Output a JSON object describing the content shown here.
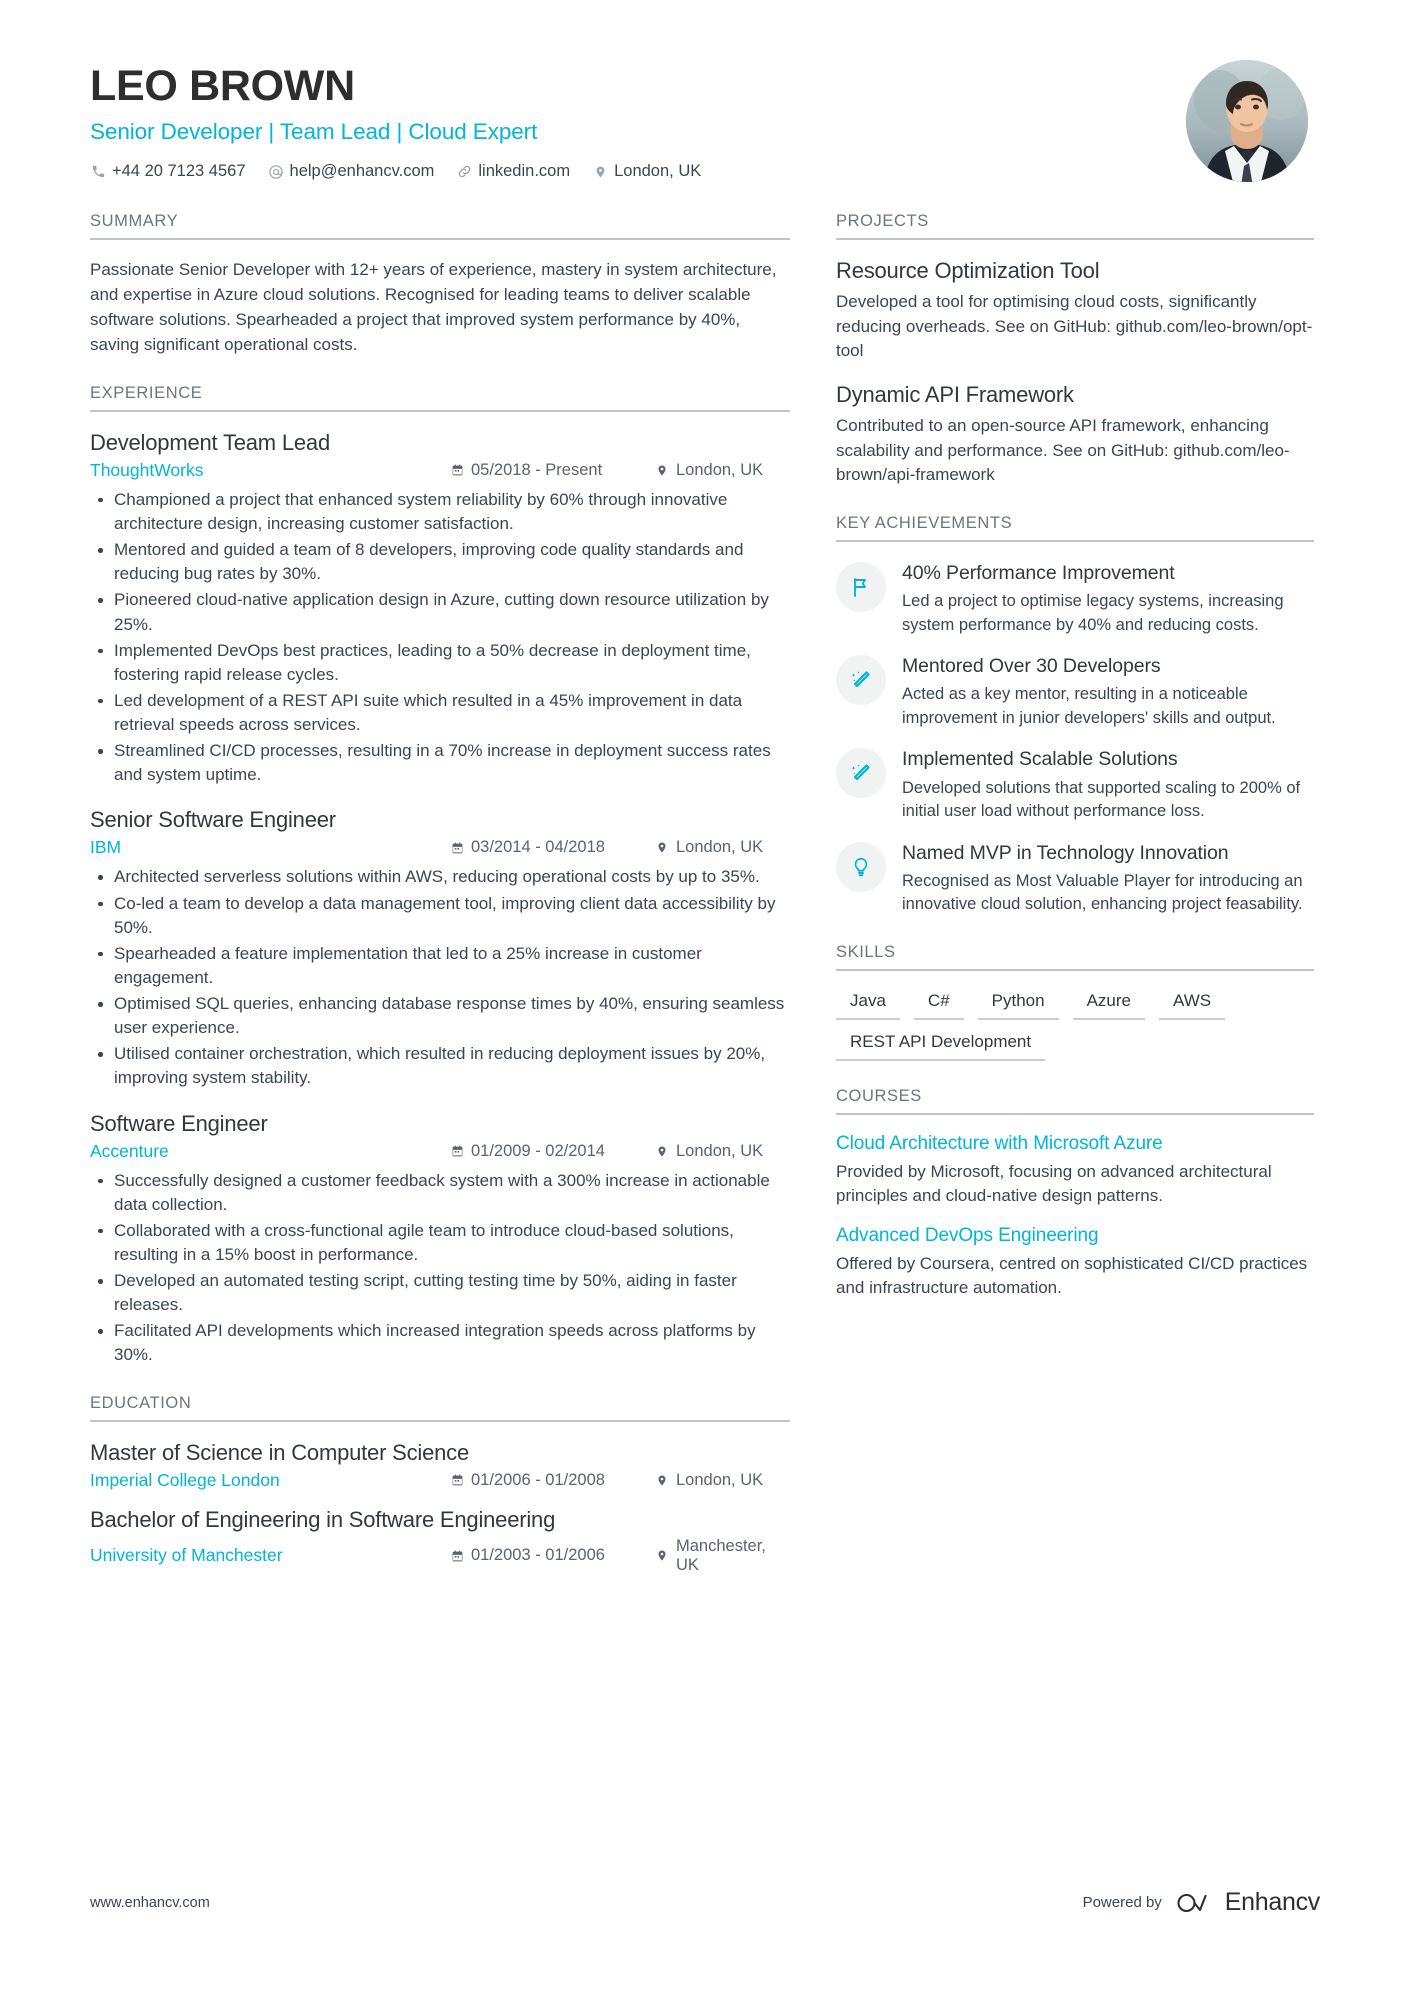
{
  "colors": {
    "accent": "#00b6d4",
    "text": "#3b4552",
    "heading": "#33383d",
    "muted": "#6b7480"
  },
  "header": {
    "name": "LEO BROWN",
    "role": "Senior Developer | Team Lead | Cloud Expert",
    "contacts": [
      {
        "icon": "phone-icon",
        "text": "+44 20 7123 4567"
      },
      {
        "icon": "email-icon",
        "text": "help@enhancv.com"
      },
      {
        "icon": "link-icon",
        "text": "linkedin.com"
      },
      {
        "icon": "location-icon",
        "text": "London, UK"
      }
    ]
  },
  "left": {
    "summary": {
      "title": "SUMMARY",
      "text": "Passionate Senior Developer with 12+ years of experience, mastery in system architecture, and expertise in Azure cloud solutions. Recognised for leading teams to deliver scalable software solutions. Spearheaded a project that improved system performance by 40%, saving significant operational costs."
    },
    "experience": {
      "title": "EXPERIENCE",
      "jobs": [
        {
          "title": "Development Team Lead",
          "company": "ThoughtWorks",
          "date": "05/2018 - Present",
          "location": "London, UK",
          "bullets": [
            "Championed a project that enhanced system reliability by 60% through innovative architecture design, increasing customer satisfaction.",
            "Mentored and guided a team of 8 developers, improving code quality standards and reducing bug rates by 30%.",
            "Pioneered cloud-native application design in Azure, cutting down resource utilization by 25%.",
            "Implemented DevOps best practices, leading to a 50% decrease in deployment time, fostering rapid release cycles.",
            "Led development of a REST API suite which resulted in a 45% improvement in data retrieval speeds across services.",
            "Streamlined CI/CD processes, resulting in a 70% increase in deployment success rates and system uptime."
          ]
        },
        {
          "title": "Senior Software Engineer",
          "company": "IBM",
          "date": "03/2014 - 04/2018",
          "location": "London, UK",
          "bullets": [
            "Architected serverless solutions within AWS, reducing operational costs by up to 35%.",
            "Co-led a team to develop a data management tool, improving client data accessibility by 50%.",
            "Spearheaded a feature implementation that led to a 25% increase in customer engagement.",
            "Optimised SQL queries, enhancing database response times by 40%, ensuring seamless user experience.",
            "Utilised container orchestration, which resulted in reducing deployment issues by 20%, improving system stability."
          ]
        },
        {
          "title": "Software Engineer",
          "company": "Accenture",
          "date": "01/2009 - 02/2014",
          "location": "London, UK",
          "bullets": [
            "Successfully designed a customer feedback system with a 300% increase in actionable data collection.",
            "Collaborated with a cross-functional agile team to introduce cloud-based solutions, resulting in a 15% boost in performance.",
            "Developed an automated testing script, cutting testing time by 50%, aiding in faster releases.",
            "Facilitated API developments which increased integration speeds across platforms by 30%."
          ]
        }
      ]
    },
    "education": {
      "title": "EDUCATION",
      "entries": [
        {
          "degree": "Master of Science in Computer Science",
          "school": "Imperial College London",
          "date": "01/2006 - 01/2008",
          "location": "London, UK"
        },
        {
          "degree": "Bachelor of Engineering in Software Engineering",
          "school": "University of Manchester",
          "date": "01/2003 - 01/2006",
          "location": "Manchester, UK"
        }
      ]
    }
  },
  "right": {
    "projects": {
      "title": "PROJECTS",
      "items": [
        {
          "name": "Resource Optimization Tool",
          "desc": "Developed a tool for optimising cloud costs, significantly reducing overheads. See on GitHub: github.com/leo-brown/opt-tool"
        },
        {
          "name": "Dynamic API Framework",
          "desc": "Contributed to an open-source API framework, enhancing scalability and performance. See on GitHub: github.com/leo-brown/api-framework"
        }
      ]
    },
    "achievements": {
      "title": "KEY ACHIEVEMENTS",
      "items": [
        {
          "icon": "flag-icon",
          "title": "40% Performance Improvement",
          "desc": "Led a project to optimise legacy systems, increasing system performance by 40% and reducing costs."
        },
        {
          "icon": "magic-wand-icon",
          "title": "Mentored Over 30 Developers",
          "desc": "Acted as a key mentor, resulting in a noticeable improvement in junior developers' skills and output."
        },
        {
          "icon": "magic-wand-icon",
          "title": "Implemented Scalable Solutions",
          "desc": "Developed solutions that supported scaling to 200% of initial user load without performance loss."
        },
        {
          "icon": "lightbulb-icon",
          "title": "Named MVP in Technology Innovation",
          "desc": "Recognised as Most Valuable Player for introducing an innovative cloud solution, enhancing project feasability."
        }
      ]
    },
    "skills": {
      "title": "SKILLS",
      "items": [
        "Java",
        "C#",
        "Python",
        "Azure",
        "AWS",
        "REST API Development"
      ]
    },
    "courses": {
      "title": "COURSES",
      "items": [
        {
          "name": "Cloud Architecture with Microsoft Azure",
          "desc": "Provided by Microsoft, focusing on advanced architectural principles and cloud-native design patterns."
        },
        {
          "name": "Advanced DevOps Engineering",
          "desc": "Offered by Coursera, centred on sophisticated CI/CD practices and infrastructure automation."
        }
      ]
    }
  },
  "footer": {
    "url": "www.enhancv.com",
    "powered_by": "Powered by",
    "brand": "Enhancv"
  }
}
